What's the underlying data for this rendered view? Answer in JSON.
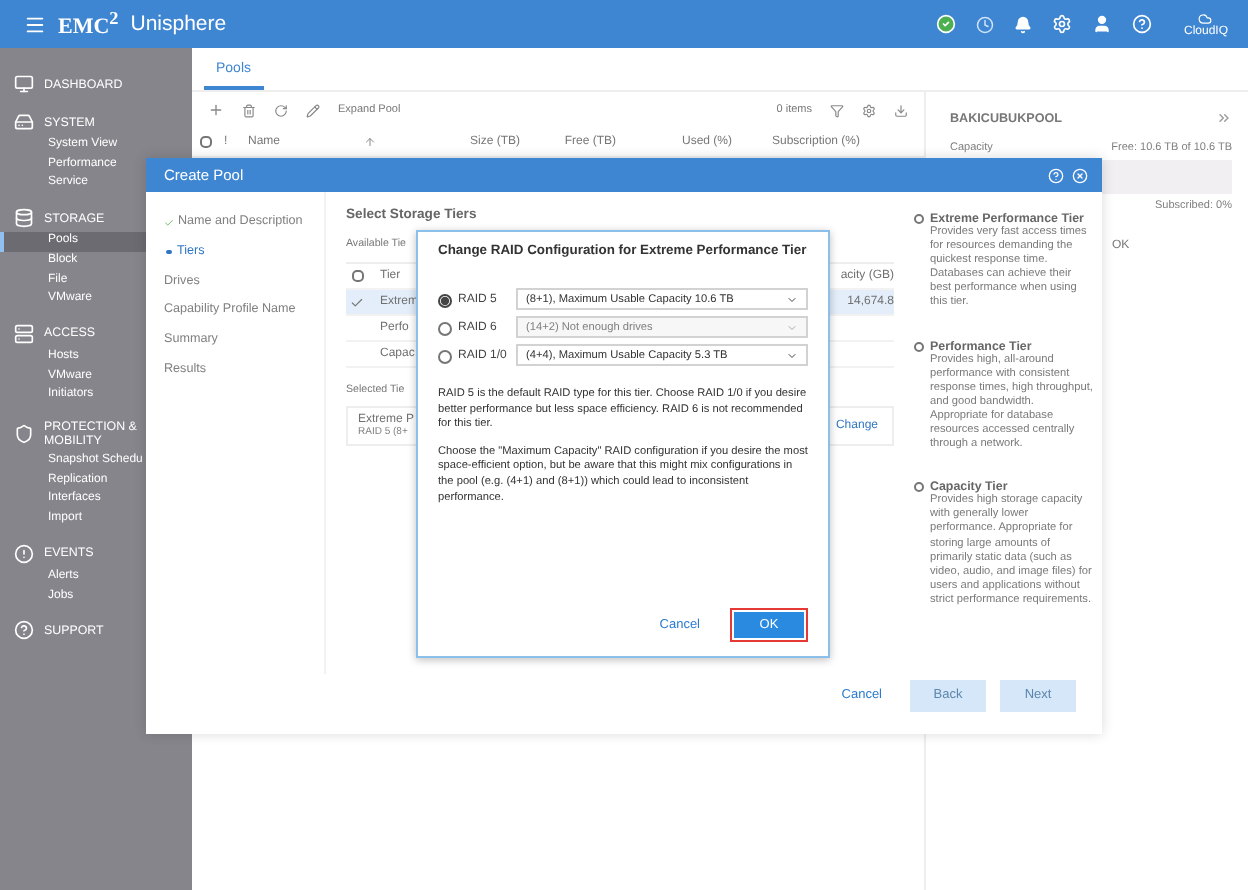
{
  "app_bar": {
    "logo": "EMC$^{2}$",
    "product": "Unisphere",
    "cloud_label": "CloudIQ"
  },
  "sidebar": {
    "sections": [
      {
        "label": "DASHBOARD"
      },
      {
        "label": "SYSTEM",
        "items": [
          {
            "label": "System View",
            "selected": false
          },
          {
            "label": "Performance",
            "selected": false
          },
          {
            "label": "Service",
            "selected": false
          }
        ]
      },
      {
        "label": "STORAGE",
        "items": [
          {
            "label": "Pools",
            "selected": true
          },
          {
            "label": "Block",
            "selected": false
          },
          {
            "label": "File",
            "selected": false
          },
          {
            "label": "VMware",
            "selected": false
          }
        ]
      },
      {
        "label": "ACCESS",
        "items": [
          {
            "label": "Hosts",
            "selected": false
          },
          {
            "label": "VMware",
            "selected": false
          },
          {
            "label": "Initiators",
            "selected": false
          }
        ]
      },
      {
        "label": "PROTECTION & MOBILITY",
        "items": [
          {
            "label": "Snapshot Schedu",
            "selected": false
          },
          {
            "label": "Replication",
            "selected": false
          },
          {
            "label": "Interfaces",
            "selected": false
          },
          {
            "label": "Import",
            "selected": false
          }
        ]
      },
      {
        "label": "EVENTS",
        "items": [
          {
            "label": "Alerts",
            "selected": false
          },
          {
            "label": "Jobs",
            "selected": false
          }
        ]
      },
      {
        "label": "SUPPORT"
      }
    ]
  },
  "tabs": [
    {
      "label": "Pools",
      "selected": true
    }
  ],
  "toolbar": {
    "action": "Expand Pool",
    "count": "0 items"
  },
  "table": {
    "select_all_checked": false,
    "columns": [
      "!",
      "Name",
      "Size (TB)",
      "Free (TB)",
      "Used (%)",
      "Subscription (%)"
    ]
  },
  "details": {
    "title": "BAKICUBUKPOOL",
    "capacity_label": "Capacity",
    "free": "Free: 10.6 TB of 10.6 TB",
    "subscribed": "Subscribed: 0%",
    "health": "OK"
  },
  "create_pool": {
    "title": "Create Pool",
    "steps": [
      {
        "label": "Name and Description",
        "completed": true,
        "selected": false
      },
      {
        "label": "Tiers",
        "completed": false,
        "selected": true
      },
      {
        "label": "Drives",
        "completed": false,
        "selected": false
      },
      {
        "label": "Capability Profile Name",
        "completed": false,
        "selected": false
      },
      {
        "label": "Summary",
        "completed": false,
        "selected": false
      },
      {
        "label": "Results",
        "completed": false,
        "selected": false
      }
    ],
    "heading": "Select Storage Tiers",
    "available_label": "Available Tie",
    "tier_table": {
      "select_all_checked": false,
      "columns": [
        "Tier",
        "acity (GB)"
      ],
      "rows": [
        {
          "tier": "Extrem",
          "capacity": "14,674.8",
          "checked": true,
          "selected": true
        },
        {
          "tier": "Perfo",
          "checked": false,
          "selected": false
        },
        {
          "tier": "Capac",
          "checked": false,
          "selected": false
        }
      ]
    },
    "selected_label": "Selected Tie",
    "selected_tier": {
      "name": "Extreme P",
      "raid": "RAID 5 (8+",
      "action": "Change"
    },
    "tier_info": [
      {
        "title": "Extreme Performance Tier",
        "description": "Provides very fast access times for resources demanding the quickest response time. Databases can achieve their best performance when using this tier.",
        "selected": false
      },
      {
        "title": "Performance Tier",
        "description": "Provides high, all-around performance with consistent response times, high throughput, and good bandwidth. Appropriate for database resources accessed centrally through a network.",
        "selected": false
      },
      {
        "title": "Capacity Tier",
        "description": "Provides high storage capacity with generally lower performance. Appropriate for storing large amounts of primarily static data (such as video, audio, and image files) for users and applications without strict performance requirements.",
        "selected": false
      }
    ],
    "buttons": [
      {
        "label": "Cancel",
        "kind": "link",
        "disabled": false
      },
      {
        "label": "Back",
        "kind": "primary",
        "disabled": true
      },
      {
        "label": "Next",
        "kind": "primary",
        "disabled": true
      }
    ]
  },
  "raid_dialog": {
    "title": "Change RAID Configuration for Extreme Performance Tier",
    "options": [
      {
        "label": "RAID 5",
        "value": "(8+1), Maximum Usable Capacity 10.6 TB",
        "selected": true,
        "disabled": false
      },
      {
        "label": "RAID 6",
        "value": "(14+2) Not enough drives",
        "selected": false,
        "disabled": true
      },
      {
        "label": "RAID 1/0",
        "value": "(4+4), Maximum Usable Capacity 5.3 TB",
        "selected": false,
        "disabled": false
      }
    ],
    "paragraphs": [
      "RAID 5 is the default RAID type for this tier. Choose RAID 1/0 if you desire better performance but less space efficiency. RAID 6 is not recommended for this tier.",
      "Choose the \"Maximum Capacity\" RAID configuration if you desire the most space-efficient option, but be aware that this might mix configurations in the pool (e.g. (4+1) and (8+1)) which could lead to inconsistent performance."
    ],
    "buttons": [
      {
        "label": "Cancel",
        "kind": "link",
        "highlighted": false
      },
      {
        "label": "OK",
        "kind": "primary",
        "highlighted": true
      }
    ]
  }
}
